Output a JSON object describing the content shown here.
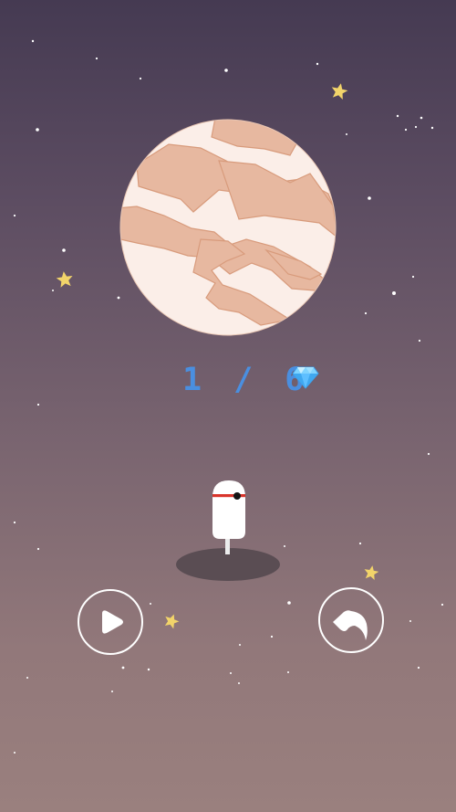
{
  "hud": {
    "level_progress": "1 / 6",
    "gem_icon": "diamond-gem-icon"
  },
  "controls": {
    "play_icon": "play-icon",
    "back_icon": "back-arrow-icon"
  },
  "colors": {
    "counter": "#4a8fe0",
    "planet_base": "#fbeee8",
    "planet_band": "#e7b8a0",
    "star": "#f2d46a"
  }
}
